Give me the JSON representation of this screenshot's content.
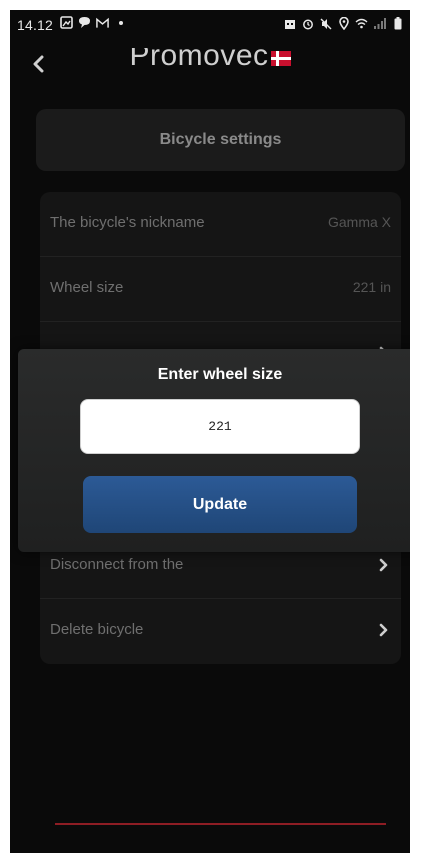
{
  "status_bar": {
    "time": "14.12",
    "left_icons": [
      "gallery-icon",
      "chat-icon",
      "mail-icon",
      "dot-icon"
    ],
    "right_icons": [
      "app-icon",
      "alarm-icon",
      "mute-icon",
      "location-icon",
      "wifi-icon",
      "signal-icon",
      "battery-icon"
    ]
  },
  "header": {
    "brand": "Promovec"
  },
  "section": {
    "title": "Bicycle settings"
  },
  "settings": {
    "nickname_label": "The bicycle's nickname",
    "nickname_value": "Gamma X",
    "wheel_label": "Wheel size",
    "wheel_value": "221 in",
    "disconnect_label": "Disconnect from the",
    "delete_label": "Delete bicycle"
  },
  "modal": {
    "title": "Enter wheel size",
    "input_value": "221",
    "button_label": "Update"
  },
  "colors": {
    "accent_blue": "#2c5a96",
    "brand_red": "#c8102e",
    "background": "#0a0a0a"
  }
}
